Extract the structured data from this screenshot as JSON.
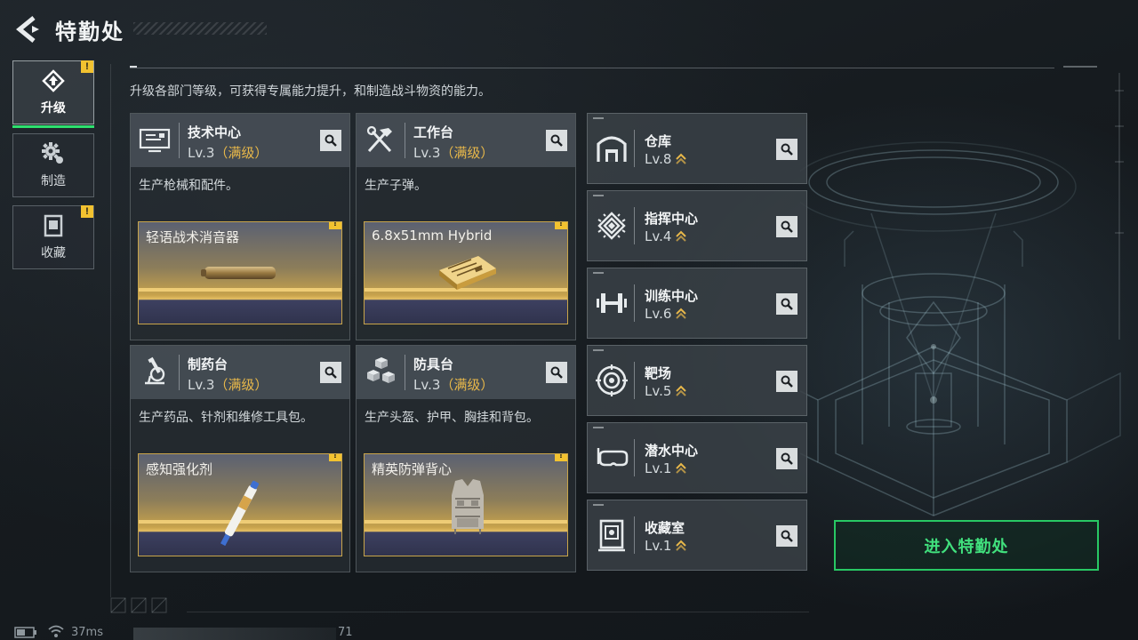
{
  "header": {
    "title": "特勤处"
  },
  "description": "升级各部门等级，可获得专属能力提升，和制造战斗物资的能力。",
  "side_tabs": [
    {
      "label": "升级",
      "active": true,
      "warning": "!"
    },
    {
      "label": "制造",
      "active": false
    },
    {
      "label": "收藏",
      "active": false,
      "warning": "!"
    }
  ],
  "departments": [
    {
      "name": "技术中心",
      "level": "Lv.3",
      "maxed": "（满级）",
      "desc": "生产枪械和配件。",
      "product": "轻语战术消音器",
      "product_badge": "!"
    },
    {
      "name": "工作台",
      "level": "Lv.3",
      "maxed": "（满级）",
      "desc": "生产子弹。",
      "product": "6.8x51mm Hybrid",
      "product_badge": "!"
    },
    {
      "name": "制药台",
      "level": "Lv.3",
      "maxed": "（满级）",
      "desc": "生产药品、针剂和维修工具包。",
      "product": "感知强化剂",
      "product_badge": "!"
    },
    {
      "name": "防具台",
      "level": "Lv.3",
      "maxed": "（满级）",
      "desc": "生产头盔、护甲、胸挂和背包。",
      "product": "精英防弹背心",
      "product_badge": "!"
    }
  ],
  "facilities": [
    {
      "name": "仓库",
      "level": "Lv.8",
      "icon": "warehouse-icon"
    },
    {
      "name": "指挥中心",
      "level": "Lv.4",
      "icon": "chip-icon"
    },
    {
      "name": "训练中心",
      "level": "Lv.6",
      "icon": "dumbbell-icon"
    },
    {
      "name": "靶场",
      "level": "Lv.5",
      "icon": "target-icon"
    },
    {
      "name": "潜水中心",
      "level": "Lv.1",
      "icon": "diving-mask-icon"
    },
    {
      "name": "收藏室",
      "level": "Lv.1",
      "icon": "collection-icon"
    }
  ],
  "enter_button": "进入特勤处",
  "status": {
    "ping": "37ms",
    "fps": "71"
  },
  "colors": {
    "accent_green": "#2ee06e",
    "maxed_gold": "#e8b84a",
    "warning_yellow": "#f2c230"
  }
}
